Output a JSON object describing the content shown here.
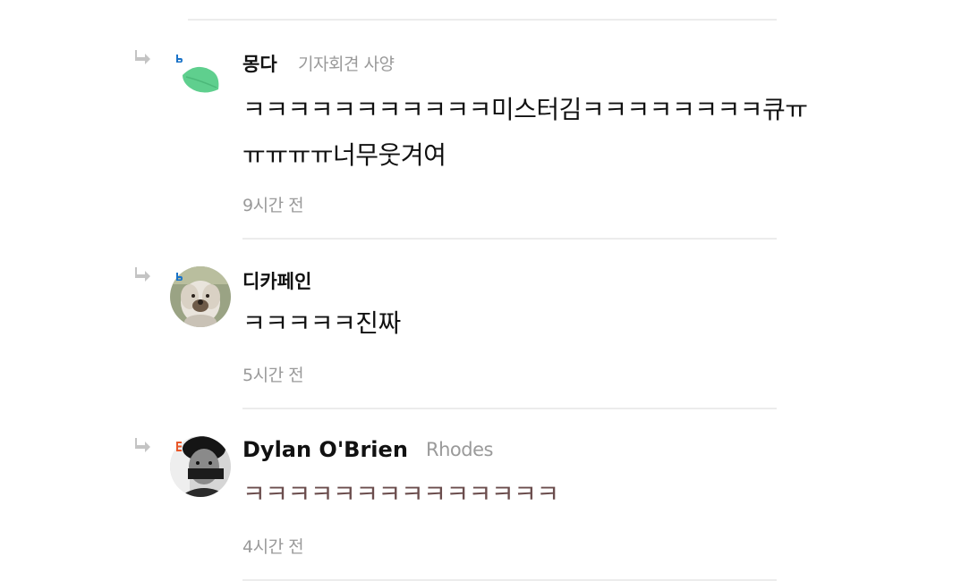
{
  "comments": [
    {
      "author": "몽다",
      "subtitle": "기자회견 사양",
      "body_lines": [
        "ㅋㅋㅋㅋㅋㅋㅋㅋㅋㅋㅋ미스터김ㅋㅋㅋㅋㅋㅋㅋㅋ큐ㅠ",
        "ㅠㅠㅠㅠ너무웃겨여"
      ],
      "time": "9시간 전",
      "badge_color": "#1a73c8",
      "avatar": "leaf-avatar"
    },
    {
      "author": "디카페인",
      "subtitle": "",
      "body_lines": [
        "ㅋㅋㅋㅋㅋ진짜"
      ],
      "time": "5시간 전",
      "badge_color": "#1a73c8",
      "avatar": "dog-avatar"
    },
    {
      "author": "Dylan O'Brien",
      "subtitle": "Rhodes",
      "body_lines": [
        "ㅋㅋㅋㅋㅋㅋㅋㅋㅋㅋㅋㅋㅋㅋ"
      ],
      "time": "4시간 전",
      "badge_color": "#e8582a",
      "avatar": "person-avatar"
    }
  ],
  "colors": {
    "divider": "#ececec",
    "meta_text": "#9a9a9a",
    "reply_icon": "#c4c4c4",
    "third_body_text": "#6b4d4d"
  }
}
